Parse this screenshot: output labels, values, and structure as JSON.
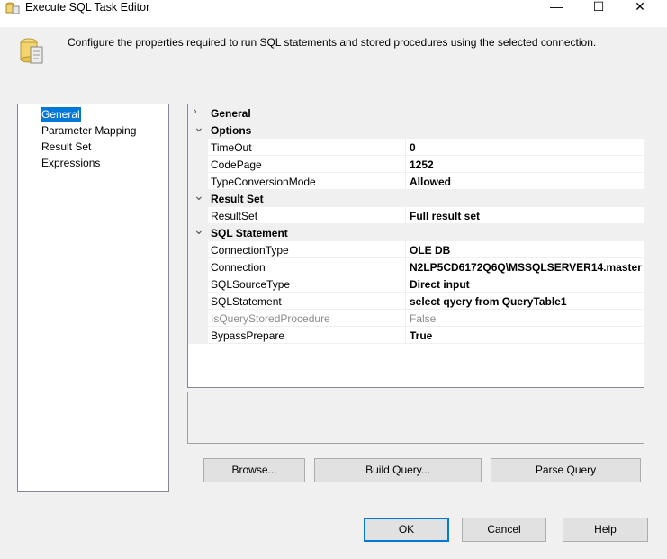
{
  "window": {
    "title": "Execute SQL Task Editor",
    "minimize": "—",
    "maximize": "☐",
    "close": "✕"
  },
  "header": {
    "description": "Configure the properties required to run SQL statements and stored procedures using the selected connection.",
    "icon": "database-script-icon"
  },
  "nav": {
    "items": [
      {
        "label": "General",
        "selected": true
      },
      {
        "label": "Parameter Mapping"
      },
      {
        "label": "Result Set"
      },
      {
        "label": "Expressions"
      }
    ]
  },
  "grid": {
    "rows": [
      {
        "type": "category",
        "name": "General",
        "expanded": false
      },
      {
        "type": "category",
        "name": "Options",
        "expanded": true
      },
      {
        "type": "prop",
        "name": "TimeOut",
        "value": "0"
      },
      {
        "type": "prop",
        "name": "CodePage",
        "value": "1252"
      },
      {
        "type": "prop",
        "name": "TypeConversionMode",
        "value": "Allowed"
      },
      {
        "type": "category",
        "name": "Result Set",
        "expanded": true
      },
      {
        "type": "prop",
        "name": "ResultSet",
        "value": "Full result set"
      },
      {
        "type": "category",
        "name": "SQL Statement",
        "expanded": true
      },
      {
        "type": "prop",
        "name": "ConnectionType",
        "value": "OLE DB"
      },
      {
        "type": "prop",
        "name": "Connection",
        "value": "N2LP5CD6172Q6Q\\MSSQLSERVER14.master"
      },
      {
        "type": "prop",
        "name": "SQLSourceType",
        "value": "Direct input"
      },
      {
        "type": "prop",
        "name": "SQLStatement",
        "value": "select qyery from QueryTable1"
      },
      {
        "type": "prop",
        "name": "IsQueryStoredProcedure",
        "value": "False",
        "disabled": true
      },
      {
        "type": "prop",
        "name": "BypassPrepare",
        "value": "True"
      }
    ]
  },
  "buttons": {
    "browse": "Browse...",
    "build_query": "Build Query...",
    "parse_query": "Parse Query",
    "ok": "OK",
    "cancel": "Cancel",
    "help": "Help"
  },
  "colors": {
    "selection": "#0078d7"
  }
}
